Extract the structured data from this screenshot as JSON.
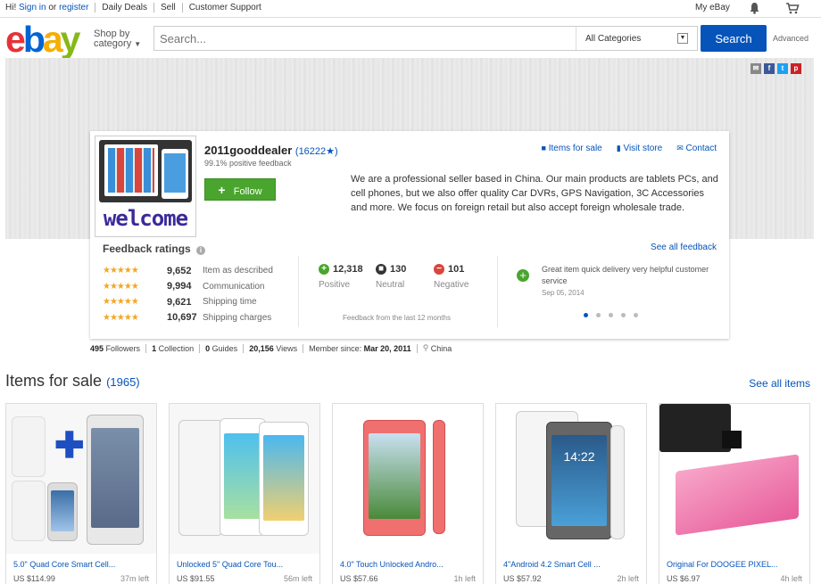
{
  "topbar": {
    "greeting": "Hi!",
    "sign_in": "Sign in",
    "or": "or",
    "register": "register",
    "daily_deals": "Daily Deals",
    "sell": "Sell",
    "customer_support": "Customer Support",
    "my_ebay": "My eBay"
  },
  "header": {
    "logo": {
      "e": "e",
      "b": "b",
      "a": "a",
      "y": "y"
    },
    "shop_by_line1": "Shop by",
    "shop_by_line2": "category",
    "search_placeholder": "Search...",
    "category_selected": "All Categories",
    "search_button": "Search",
    "advanced": "Advanced"
  },
  "store": {
    "logo_text": "welcome",
    "seller_name": "2011gooddealer",
    "feedback_score": "(16222★)",
    "positive_feedback": "99.1% positive feedback",
    "follow_label": "Follow",
    "links": {
      "items_for_sale": "Items for sale",
      "visit_store": "Visit store",
      "contact": "Contact"
    },
    "description": "We are a professional seller based in China. Our main products are tablets PCs, and cell phones, but we also offer quality Car DVRs, GPS Navigation, 3C Accessories and more. We focus on foreign retail but also accept foreign wholesale trade."
  },
  "feedback": {
    "title": "Feedback ratings",
    "see_all": "See all feedback",
    "ratings": [
      {
        "stars": "★★★★★",
        "count": "9,652",
        "label": "Item as described"
      },
      {
        "stars": "★★★★★",
        "count": "9,994",
        "label": "Communication"
      },
      {
        "stars": "★★★★★",
        "count": "9,621",
        "label": "Shipping time"
      },
      {
        "stars": "★★★★★",
        "count": "10,697",
        "label": "Shipping charges"
      }
    ],
    "positive": {
      "count": "12,318",
      "label": "Positive"
    },
    "neutral": {
      "count": "130",
      "label": "Neutral"
    },
    "negative": {
      "count": "101",
      "label": "Negative"
    },
    "note": "Feedback from the last 12 months",
    "comment": {
      "text": "Great item quick delivery very helpful customer service",
      "date": "Sep 05, 2014"
    }
  },
  "stats": {
    "followers_num": "495",
    "followers_label": "Followers",
    "collection_num": "1",
    "collection_label": "Collection",
    "guides_num": "0",
    "guides_label": "Guides",
    "views_num": "20,156",
    "views_label": "Views",
    "member_label": "Member since:",
    "member_date": "Mar 20, 2011",
    "location": "China"
  },
  "items": {
    "title": "Items for sale",
    "count": "(1965)",
    "see_all": "See all items",
    "list": [
      {
        "title": "5.0\" Quad Core Smart Cell...",
        "price": "US $114.99",
        "time": "37m left"
      },
      {
        "title": "Unlocked 5\" Quad Core Tou...",
        "price": "US $91.55",
        "time": "56m left"
      },
      {
        "title": "4.0\" Touch Unlocked Andro...",
        "price": "US $57.66",
        "time": "1h left"
      },
      {
        "title": "4\"Android 4.2 Smart Cell ...",
        "price": "US $57.92",
        "time": "2h left"
      },
      {
        "title": "Original For DOOGEE PIXEL...",
        "price": "US $6.97",
        "time": "4h left"
      }
    ],
    "clock_text": "14:22"
  }
}
